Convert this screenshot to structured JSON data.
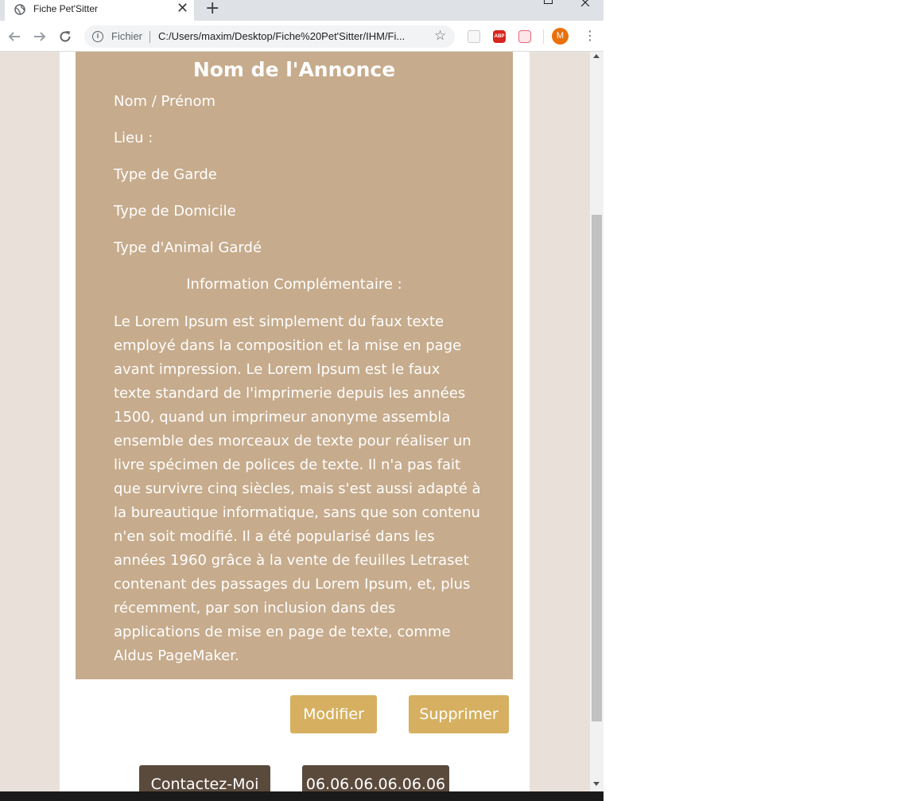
{
  "browser": {
    "tab_title": "Fiche Pet'Sitter",
    "tab_close": "✕",
    "new_tab": "+",
    "scheme_label": "Fichier",
    "url": "C:/Users/maxim/Desktop/Fiche%20Pet'Sitter/IHM/Fi...",
    "profile_initial": "M",
    "abp_label": "ABP",
    "icons": [
      "globe-icon",
      "back-arrow-icon",
      "forward-arrow-icon",
      "reload-icon",
      "info-icon",
      "star-icon",
      "pocket-icon",
      "adblock-icon",
      "piggy-icon",
      "menu-dots-icon"
    ]
  },
  "ad": {
    "title": "Nom de l'Annonce",
    "name_label": "Nom / Prénom",
    "location_label": "Lieu :",
    "care_type_label": "Type de Garde",
    "home_type_label": "Type de Domicile",
    "animal_type_label": "Type d'Animal Gardé",
    "info_heading": "Information Complémentaire :",
    "info_text": "Le Lorem Ipsum est simplement du faux texte employé dans la composition et la mise en page avant impression. Le Lorem Ipsum est le faux texte standard de l'imprimerie depuis les années 1500, quand un imprimeur anonyme assembla ensemble des morceaux de texte pour réaliser un livre spécimen de polices de texte. Il n'a pas fait que survivre cinq siècles, mais s'est aussi adapté à la bureautique informatique, sans que son contenu n'en soit modifié. Il a été popularisé dans les années 1960 grâce à la vente de feuilles Letraset contenant des passages du Lorem Ipsum, et, plus récemment, par son inclusion dans des applications de mise en page de texte, comme Aldus PageMaker."
  },
  "actions": {
    "modify_label": "Modifier",
    "delete_label": "Supprimer",
    "contact_label": "Contactez-Moi",
    "phone_label": "06.06.06.06.06.06"
  },
  "colors": {
    "card_bg": "#c6ab8c",
    "gold_button": "#d6b060",
    "dark_button": "#5a4a3c",
    "page_bg": "#e9e1d9"
  }
}
